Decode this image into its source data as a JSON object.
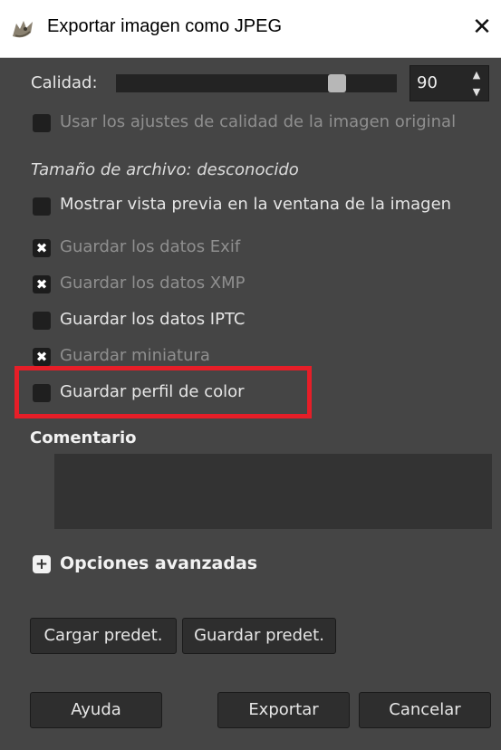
{
  "window": {
    "title": "Exportar imagen como JPEG",
    "close_glyph": "✕"
  },
  "quality": {
    "label": "Calidad:",
    "value": "90",
    "percent": 90,
    "up": "▲",
    "down": "▼"
  },
  "options": {
    "original_quality": {
      "label": "Usar los ajustes de calidad de la imagen original",
      "checked": false,
      "enabled": false
    },
    "file_size": "Tamaño de archivo: desconocido",
    "preview": {
      "label": "Mostrar vista previa en la ventana de la imagen",
      "checked": false,
      "enabled": true
    },
    "exif": {
      "label": "Guardar los datos Exif",
      "checked": true,
      "enabled": false
    },
    "xmp": {
      "label": "Guardar los datos XMP",
      "checked": true,
      "enabled": false
    },
    "iptc": {
      "label": "Guardar los datos IPTC",
      "checked": false,
      "enabled": true
    },
    "thumbnail": {
      "label": "Guardar miniatura",
      "checked": true,
      "enabled": false
    },
    "color_profile": {
      "label": "Guardar perfil de color",
      "checked": false,
      "enabled": true
    }
  },
  "comment": {
    "label": "Comentario",
    "value": ""
  },
  "advanced": {
    "label": "Opciones avanzadas",
    "glyph": "+"
  },
  "buttons": {
    "load_defaults": "Cargar predet.",
    "save_defaults": "Guardar predet.",
    "help": "Ayuda",
    "export": "Exportar",
    "cancel": "Cancelar"
  },
  "icons": {
    "app": "gimp-wilber-icon",
    "close": "close-icon",
    "check": "✖"
  },
  "colors": {
    "dialog_bg": "#454545",
    "highlight": "#e61e28"
  }
}
